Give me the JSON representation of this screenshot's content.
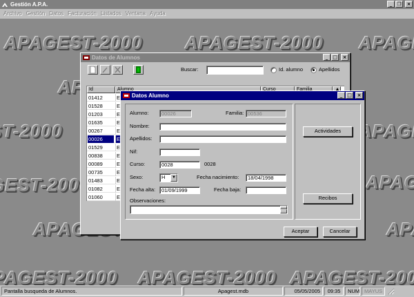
{
  "app": {
    "title": "Gestión A.P.A.",
    "menu": [
      "Archivo",
      "Gestión",
      "Datos",
      "Facturación",
      "Listados",
      "Ventana",
      "Ayuda"
    ],
    "watermark": "APAGEST-2000"
  },
  "alumnos_window": {
    "title": "Datos de Alumnos",
    "buscar_label": "Buscar:",
    "buscar_value": "",
    "radio_id_label": "Id. alumno",
    "radio_apellidos_label": "Apellidos",
    "selected_radio": "apellidos",
    "columns": [
      "Id",
      "Alumno",
      "Curso",
      "Familia"
    ],
    "rows": [
      {
        "id": "01412",
        "alumno": "E"
      },
      {
        "id": "01528",
        "alumno": "E"
      },
      {
        "id": "01203",
        "alumno": "E"
      },
      {
        "id": "01635",
        "alumno": "E"
      },
      {
        "id": "00267",
        "alumno": "E"
      },
      {
        "id": "00026",
        "alumno": "E",
        "selected": true
      },
      {
        "id": "01529",
        "alumno": "E"
      },
      {
        "id": "00838",
        "alumno": "E"
      },
      {
        "id": "00089",
        "alumno": "E"
      },
      {
        "id": "00735",
        "alumno": "E"
      },
      {
        "id": "01483",
        "alumno": "E"
      },
      {
        "id": "01082",
        "alumno": "E"
      },
      {
        "id": "01060",
        "alumno": "E"
      }
    ]
  },
  "form": {
    "title": "Datos Alumno",
    "alumno_label": "Alumno:",
    "alumno_value": "00026",
    "familia_label": "Familia:",
    "familia_value": "00536",
    "nombre_label": "Nombre:",
    "nombre_value": "",
    "apellidos_label": "Apellidos:",
    "apellidos_value": "",
    "nif_label": "Nif:",
    "nif_value": "",
    "curso_label": "Curso:",
    "curso_value": "0028",
    "curso_text": "0028",
    "sexo_label": "Sexo:",
    "sexo_value": "H",
    "fecha_nac_label": "Fecha nacimiento:",
    "fecha_nac_value": "18/04/1998",
    "fecha_alta_label": "Fecha alta:",
    "fecha_alta_value": "01/09/1999",
    "fecha_baja_label": "Fecha baja:",
    "fecha_baja_value": "",
    "observaciones_label": "Observaciones:",
    "observaciones_value": "",
    "actividades_label": "Actividades",
    "recibos_label": "Recibos",
    "aceptar_label": "Aceptar",
    "cancelar_label": "Cancelar"
  },
  "status": {
    "message": "Pantalla busqueda de Alumnos.",
    "database": "Apagest.mdb",
    "date": "05/05/2005",
    "time": "09:35",
    "num": "NUM",
    "mayus": "MAYUS"
  },
  "colors": {
    "active_title": "#000080",
    "inactive_title": "#808080",
    "face": "#c0c0c0",
    "desktop": "#8a8a8a"
  }
}
